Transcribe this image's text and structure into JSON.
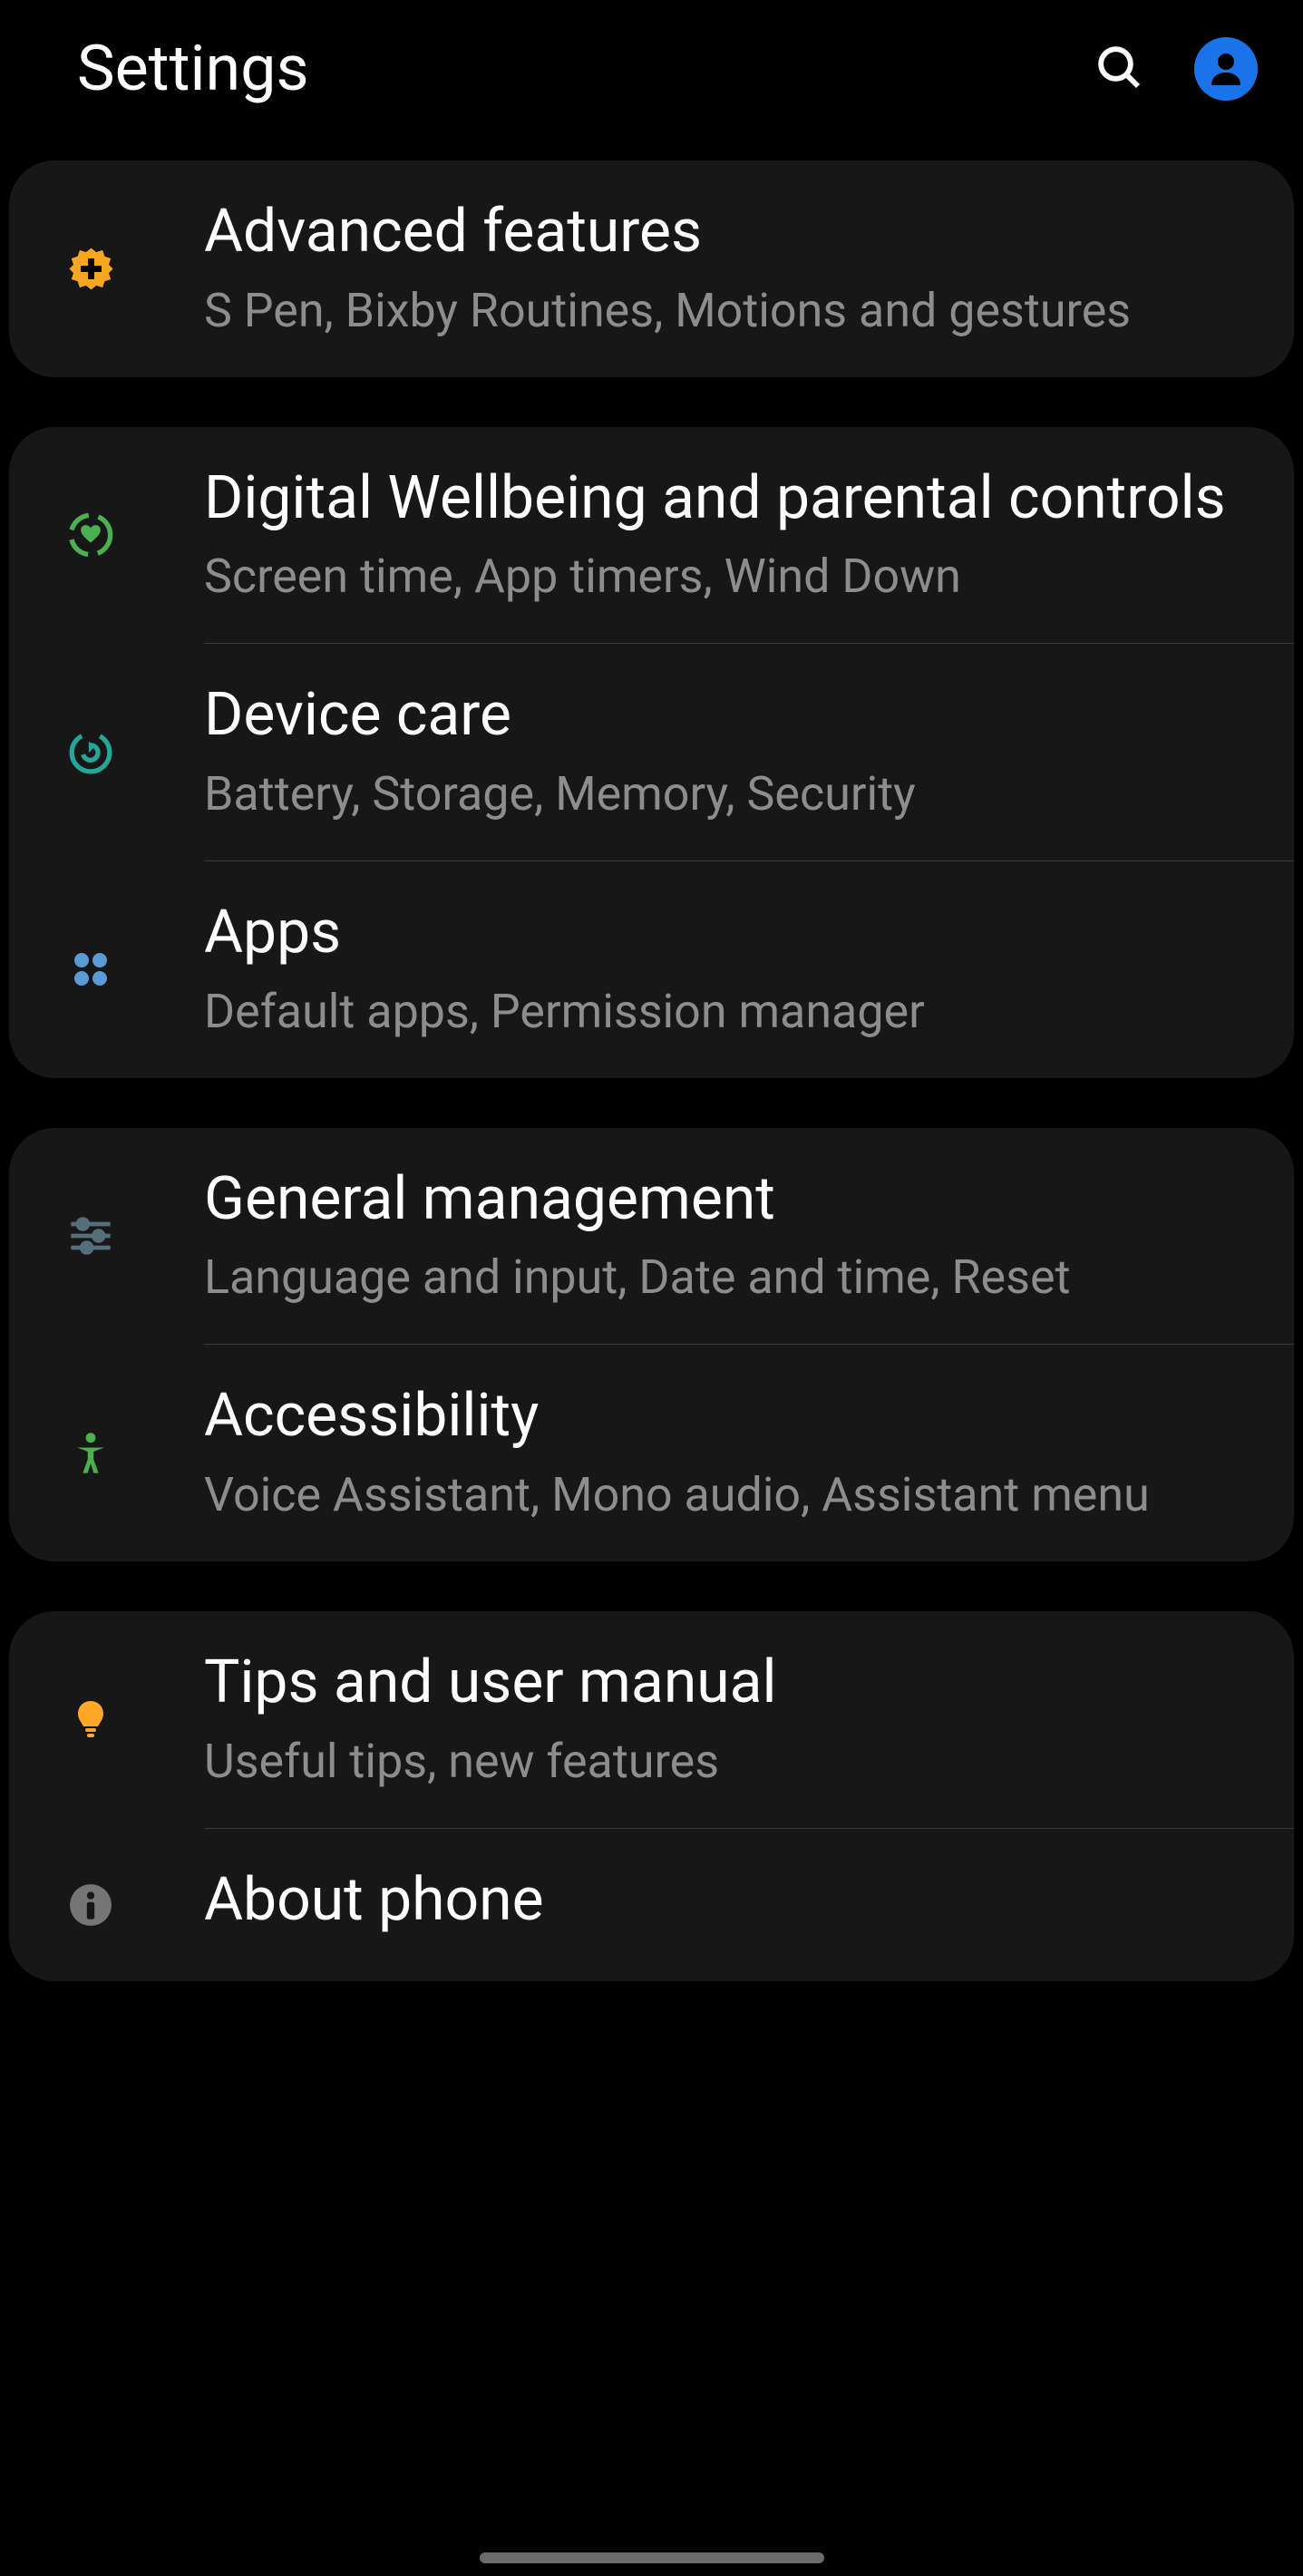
{
  "header": {
    "title": "Settings"
  },
  "groups": [
    {
      "items": [
        {
          "id": "advanced-features",
          "title": "Advanced features",
          "subtitle": "S Pen, Bixby Routines, Motions and gestures"
        }
      ]
    },
    {
      "items": [
        {
          "id": "digital-wellbeing",
          "title": "Digital Wellbeing and parental controls",
          "subtitle": "Screen time, App timers, Wind Down"
        },
        {
          "id": "device-care",
          "title": "Device care",
          "subtitle": "Battery, Storage, Memory, Security"
        },
        {
          "id": "apps",
          "title": "Apps",
          "subtitle": "Default apps, Permission manager"
        }
      ]
    },
    {
      "items": [
        {
          "id": "general-management",
          "title": "General management",
          "subtitle": "Language and input, Date and time, Reset"
        },
        {
          "id": "accessibility",
          "title": "Accessibility",
          "subtitle": "Voice Assistant, Mono audio, Assistant menu"
        }
      ]
    },
    {
      "items": [
        {
          "id": "tips",
          "title": "Tips and user manual",
          "subtitle": "Useful tips, new features"
        },
        {
          "id": "about-phone",
          "title": "About phone",
          "subtitle": ""
        }
      ]
    }
  ]
}
